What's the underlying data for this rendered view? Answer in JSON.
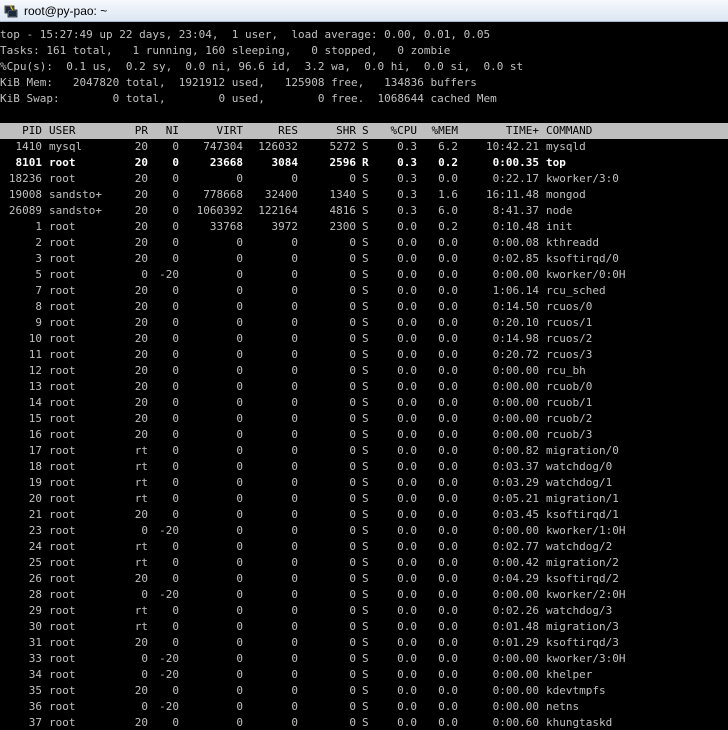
{
  "window": {
    "title": "root@py-pao: ~",
    "icon": "putty-terminal-icon"
  },
  "summary": [
    "top - 15:27:49 up 22 days, 23:04,  1 user,  load average: 0.00, 0.01, 0.05",
    "Tasks: 161 total,   1 running, 160 sleeping,   0 stopped,   0 zombie",
    "%Cpu(s):  0.1 us,  0.2 sy,  0.0 ni, 96.6 id,  3.2 wa,  0.0 hi,  0.0 si,  0.0 st",
    "KiB Mem:   2047820 total,  1921912 used,   125908 free,   134836 buffers",
    "KiB Swap:        0 total,        0 used,        0 free.  1068644 cached Mem"
  ],
  "columns": [
    "PID",
    "USER",
    "PR",
    "NI",
    "VIRT",
    "RES",
    "SHR",
    "S",
    "%CPU",
    "%MEM",
    "TIME+",
    "COMMAND"
  ],
  "processes": [
    [
      "1410",
      "mysql",
      "20",
      "0",
      "747304",
      "126032",
      "5272",
      "S",
      "0.3",
      "6.2",
      "10:42.21",
      "mysqld"
    ],
    [
      "8101",
      "root",
      "20",
      "0",
      "23668",
      "3084",
      "2596",
      "R",
      "0.3",
      "0.2",
      "0:00.35",
      "top"
    ],
    [
      "18236",
      "root",
      "20",
      "0",
      "0",
      "0",
      "0",
      "S",
      "0.3",
      "0.0",
      "0:22.17",
      "kworker/3:0"
    ],
    [
      "19008",
      "sandsto+",
      "20",
      "0",
      "778668",
      "32400",
      "1340",
      "S",
      "0.3",
      "1.6",
      "16:11.48",
      "mongod"
    ],
    [
      "26089",
      "sandsto+",
      "20",
      "0",
      "1060392",
      "122164",
      "4816",
      "S",
      "0.3",
      "6.0",
      "8:41.37",
      "node"
    ],
    [
      "1",
      "root",
      "20",
      "0",
      "33768",
      "3972",
      "2300",
      "S",
      "0.0",
      "0.2",
      "0:10.48",
      "init"
    ],
    [
      "2",
      "root",
      "20",
      "0",
      "0",
      "0",
      "0",
      "S",
      "0.0",
      "0.0",
      "0:00.08",
      "kthreadd"
    ],
    [
      "3",
      "root",
      "20",
      "0",
      "0",
      "0",
      "0",
      "S",
      "0.0",
      "0.0",
      "0:02.85",
      "ksoftirqd/0"
    ],
    [
      "5",
      "root",
      "0",
      "-20",
      "0",
      "0",
      "0",
      "S",
      "0.0",
      "0.0",
      "0:00.00",
      "kworker/0:0H"
    ],
    [
      "7",
      "root",
      "20",
      "0",
      "0",
      "0",
      "0",
      "S",
      "0.0",
      "0.0",
      "1:06.14",
      "rcu_sched"
    ],
    [
      "8",
      "root",
      "20",
      "0",
      "0",
      "0",
      "0",
      "S",
      "0.0",
      "0.0",
      "0:14.50",
      "rcuos/0"
    ],
    [
      "9",
      "root",
      "20",
      "0",
      "0",
      "0",
      "0",
      "S",
      "0.0",
      "0.0",
      "0:20.10",
      "rcuos/1"
    ],
    [
      "10",
      "root",
      "20",
      "0",
      "0",
      "0",
      "0",
      "S",
      "0.0",
      "0.0",
      "0:14.98",
      "rcuos/2"
    ],
    [
      "11",
      "root",
      "20",
      "0",
      "0",
      "0",
      "0",
      "S",
      "0.0",
      "0.0",
      "0:20.72",
      "rcuos/3"
    ],
    [
      "12",
      "root",
      "20",
      "0",
      "0",
      "0",
      "0",
      "S",
      "0.0",
      "0.0",
      "0:00.00",
      "rcu_bh"
    ],
    [
      "13",
      "root",
      "20",
      "0",
      "0",
      "0",
      "0",
      "S",
      "0.0",
      "0.0",
      "0:00.00",
      "rcuob/0"
    ],
    [
      "14",
      "root",
      "20",
      "0",
      "0",
      "0",
      "0",
      "S",
      "0.0",
      "0.0",
      "0:00.00",
      "rcuob/1"
    ],
    [
      "15",
      "root",
      "20",
      "0",
      "0",
      "0",
      "0",
      "S",
      "0.0",
      "0.0",
      "0:00.00",
      "rcuob/2"
    ],
    [
      "16",
      "root",
      "20",
      "0",
      "0",
      "0",
      "0",
      "S",
      "0.0",
      "0.0",
      "0:00.00",
      "rcuob/3"
    ],
    [
      "17",
      "root",
      "rt",
      "0",
      "0",
      "0",
      "0",
      "S",
      "0.0",
      "0.0",
      "0:00.82",
      "migration/0"
    ],
    [
      "18",
      "root",
      "rt",
      "0",
      "0",
      "0",
      "0",
      "S",
      "0.0",
      "0.0",
      "0:03.37",
      "watchdog/0"
    ],
    [
      "19",
      "root",
      "rt",
      "0",
      "0",
      "0",
      "0",
      "S",
      "0.0",
      "0.0",
      "0:03.29",
      "watchdog/1"
    ],
    [
      "20",
      "root",
      "rt",
      "0",
      "0",
      "0",
      "0",
      "S",
      "0.0",
      "0.0",
      "0:05.21",
      "migration/1"
    ],
    [
      "21",
      "root",
      "20",
      "0",
      "0",
      "0",
      "0",
      "S",
      "0.0",
      "0.0",
      "0:03.45",
      "ksoftirqd/1"
    ],
    [
      "23",
      "root",
      "0",
      "-20",
      "0",
      "0",
      "0",
      "S",
      "0.0",
      "0.0",
      "0:00.00",
      "kworker/1:0H"
    ],
    [
      "24",
      "root",
      "rt",
      "0",
      "0",
      "0",
      "0",
      "S",
      "0.0",
      "0.0",
      "0:02.77",
      "watchdog/2"
    ],
    [
      "25",
      "root",
      "rt",
      "0",
      "0",
      "0",
      "0",
      "S",
      "0.0",
      "0.0",
      "0:00.42",
      "migration/2"
    ],
    [
      "26",
      "root",
      "20",
      "0",
      "0",
      "0",
      "0",
      "S",
      "0.0",
      "0.0",
      "0:04.29",
      "ksoftirqd/2"
    ],
    [
      "28",
      "root",
      "0",
      "-20",
      "0",
      "0",
      "0",
      "S",
      "0.0",
      "0.0",
      "0:00.00",
      "kworker/2:0H"
    ],
    [
      "29",
      "root",
      "rt",
      "0",
      "0",
      "0",
      "0",
      "S",
      "0.0",
      "0.0",
      "0:02.26",
      "watchdog/3"
    ],
    [
      "30",
      "root",
      "rt",
      "0",
      "0",
      "0",
      "0",
      "S",
      "0.0",
      "0.0",
      "0:01.48",
      "migration/3"
    ],
    [
      "31",
      "root",
      "20",
      "0",
      "0",
      "0",
      "0",
      "S",
      "0.0",
      "0.0",
      "0:01.29",
      "ksoftirqd/3"
    ],
    [
      "33",
      "root",
      "0",
      "-20",
      "0",
      "0",
      "0",
      "S",
      "0.0",
      "0.0",
      "0:00.00",
      "kworker/3:0H"
    ],
    [
      "34",
      "root",
      "0",
      "-20",
      "0",
      "0",
      "0",
      "S",
      "0.0",
      "0.0",
      "0:00.00",
      "khelper"
    ],
    [
      "35",
      "root",
      "20",
      "0",
      "0",
      "0",
      "0",
      "S",
      "0.0",
      "0.0",
      "0:00.00",
      "kdevtmpfs"
    ],
    [
      "36",
      "root",
      "0",
      "-20",
      "0",
      "0",
      "0",
      "S",
      "0.0",
      "0.0",
      "0:00.00",
      "netns"
    ],
    [
      "37",
      "root",
      "20",
      "0",
      "0",
      "0",
      "0",
      "S",
      "0.0",
      "0.0",
      "0:00.60",
      "khungtaskd"
    ]
  ],
  "highlight_pids": [
    "8101"
  ],
  "colors": {
    "background": "#000000",
    "text": "#c0c0c0",
    "bold_text": "#ffffff",
    "header_bg": "#bfbfbf",
    "header_text": "#000000"
  }
}
